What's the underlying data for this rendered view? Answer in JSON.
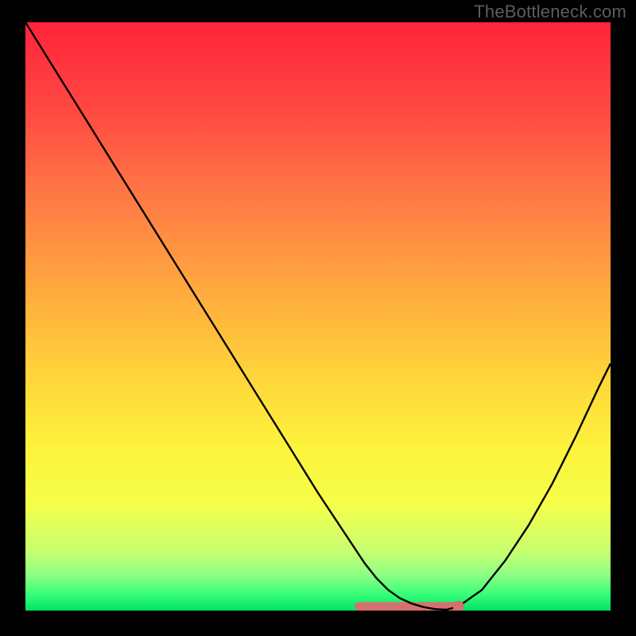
{
  "watermark": "TheBottleneck.com",
  "chart_data": {
    "type": "line",
    "title": "",
    "xlabel": "",
    "ylabel": "",
    "xlim": [
      0,
      100
    ],
    "ylim": [
      0,
      100
    ],
    "x": [
      0,
      5,
      10,
      15,
      20,
      25,
      30,
      35,
      40,
      45,
      50,
      55,
      58,
      60,
      62,
      64,
      66,
      68,
      70,
      72,
      74,
      78,
      82,
      86,
      90,
      94,
      98,
      100
    ],
    "values": [
      100,
      92,
      84,
      76,
      68,
      60,
      52,
      44,
      36,
      28,
      20,
      12.5,
      8,
      5.5,
      3.5,
      2.1,
      1.2,
      0.6,
      0.25,
      0.15,
      0.7,
      3.5,
      8.5,
      14.5,
      21.5,
      29.5,
      38,
      42
    ],
    "background": {
      "type": "vertical_gradient",
      "stops": [
        {
          "pos": 0.0,
          "color": "#ff233a"
        },
        {
          "pos": 0.15,
          "color": "#ff4942"
        },
        {
          "pos": 0.3,
          "color": "#ff7a45"
        },
        {
          "pos": 0.45,
          "color": "#ffa83e"
        },
        {
          "pos": 0.6,
          "color": "#ffd43a"
        },
        {
          "pos": 0.72,
          "color": "#fdf23c"
        },
        {
          "pos": 0.82,
          "color": "#f5ff4a"
        },
        {
          "pos": 0.9,
          "color": "#c6ff70"
        },
        {
          "pos": 0.94,
          "color": "#8cff84"
        },
        {
          "pos": 0.97,
          "color": "#3dff7a"
        },
        {
          "pos": 1.0,
          "color": "#00e463"
        }
      ]
    },
    "marker": {
      "x": 74,
      "y": 0.7,
      "color": "#d6706e",
      "radius": 7
    },
    "flat_band": {
      "x0": 57,
      "x1": 74,
      "y": 0.7,
      "color": "#d6706e",
      "thickness": 11
    },
    "curve_color": "#000000",
    "curve_width": 2.4
  }
}
